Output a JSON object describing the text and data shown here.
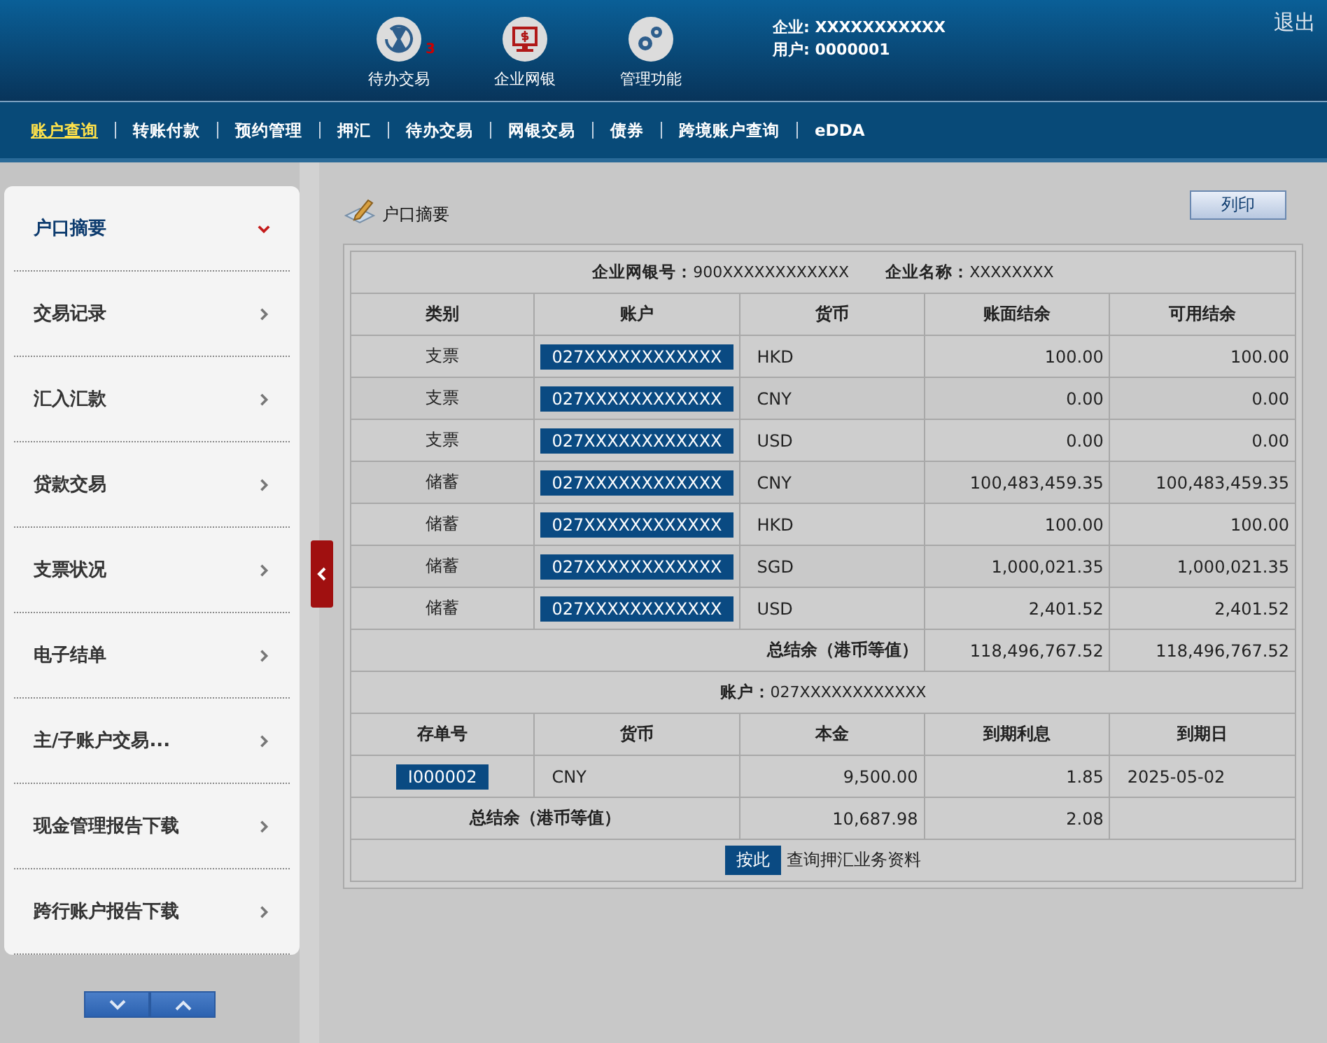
{
  "header": {
    "modules": [
      {
        "label": "待办交易",
        "selected": false,
        "badge": "3"
      },
      {
        "label": "企业网银",
        "selected": true
      },
      {
        "label": "管理功能",
        "selected": false
      }
    ],
    "company": "企业: XXXXXXXXXXX",
    "user": "用户: 0000001",
    "logout": "退出"
  },
  "nav": [
    {
      "label": "账户查询",
      "selected": true
    },
    {
      "label": "转账付款",
      "selected": false
    },
    {
      "label": "预约管理",
      "selected": false
    },
    {
      "label": "押汇",
      "selected": false
    },
    {
      "label": "待办交易",
      "selected": false
    },
    {
      "label": "网银交易",
      "selected": false
    },
    {
      "label": "债券",
      "selected": false
    },
    {
      "label": "跨境账户查询",
      "selected": false
    },
    {
      "label": "eDDA",
      "selected": false
    }
  ],
  "sidebar": {
    "items": [
      {
        "label": "户口摘要",
        "expanded": true
      },
      {
        "label": "交易记录",
        "expanded": false
      },
      {
        "label": "汇入汇款",
        "expanded": false
      },
      {
        "label": "贷款交易",
        "expanded": false
      },
      {
        "label": "支票状况",
        "expanded": false
      },
      {
        "label": "电子结单",
        "expanded": false
      },
      {
        "label": "主/子账户交易...",
        "expanded": false
      },
      {
        "label": "现金管理报告下载",
        "expanded": false
      },
      {
        "label": "跨行账户报告下载",
        "expanded": false
      }
    ]
  },
  "content": {
    "title": "户口摘要",
    "print_button": "列印",
    "info": [
      {
        "label": "企业网银号：",
        "value": "900XXXXXXXXXXXX"
      },
      {
        "label": "企业名称：",
        "value": "XXXXXXXX"
      }
    ],
    "accounts_table": {
      "columns": [
        "类别",
        "账户",
        "货币",
        "账面结余",
        "可用结余"
      ],
      "rows": [
        {
          "type": "支票",
          "account": "027XXXXXXXXXXXX",
          "currency": "HKD",
          "ledger": "100.00",
          "available": "100.00"
        },
        {
          "type": "支票",
          "account": "027XXXXXXXXXXXX",
          "currency": "CNY",
          "ledger": "0.00",
          "available": "0.00"
        },
        {
          "type": "支票",
          "account": "027XXXXXXXXXXXX",
          "currency": "USD",
          "ledger": "0.00",
          "available": "0.00"
        },
        {
          "type": "储蓄",
          "account": "027XXXXXXXXXXXX",
          "currency": "CNY",
          "ledger": "100,483,459.35",
          "available": "100,483,459.35"
        },
        {
          "type": "储蓄",
          "account": "027XXXXXXXXXXXX",
          "currency": "HKD",
          "ledger": "100.00",
          "available": "100.00"
        },
        {
          "type": "储蓄",
          "account": "027XXXXXXXXXXXX",
          "currency": "SGD",
          "ledger": "1,000,021.35",
          "available": "1,000,021.35"
        },
        {
          "type": "储蓄",
          "account": "027XXXXXXXXXXXX",
          "currency": "USD",
          "ledger": "2,401.52",
          "available": "2,401.52"
        }
      ],
      "total": {
        "label": "总结余（港币等值）",
        "ledger": "118,496,767.52",
        "available": "118,496,767.52"
      }
    },
    "deposit_table": {
      "account_label": "账户：",
      "account": "027XXXXXXXXXXXX",
      "columns": [
        "存单号",
        "货币",
        "本金",
        "到期利息",
        "到期日"
      ],
      "rows": [
        {
          "number": "I000002",
          "currency": "CNY",
          "principal": "9,500.00",
          "interest": "1.85",
          "maturity": "2025-05-02"
        }
      ],
      "total": {
        "label": "总结余（港币等值）",
        "principal": "10,687.98",
        "interest": "2.08"
      }
    },
    "footer": {
      "button": "按此",
      "text": "查询押汇业务资料"
    }
  }
}
